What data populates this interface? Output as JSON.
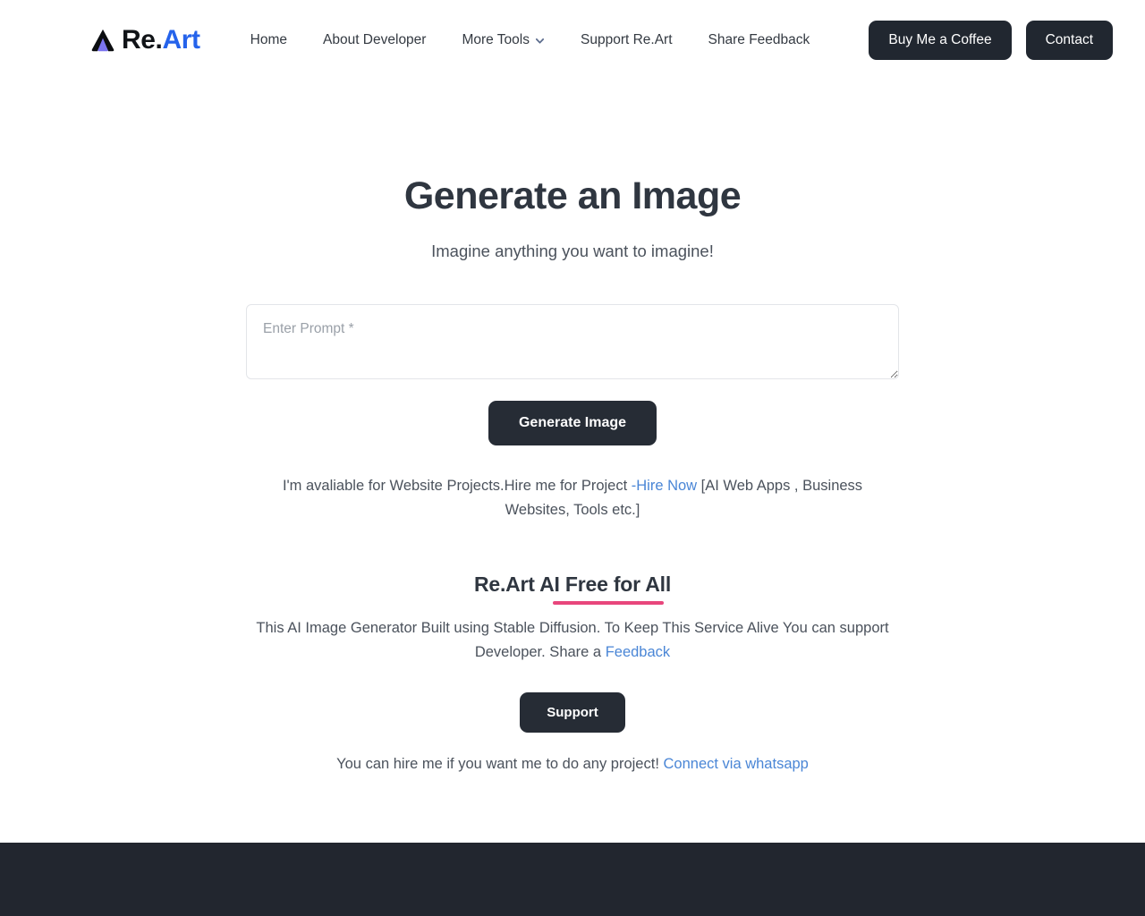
{
  "brand": {
    "logo_icon": "triangle-logo-icon",
    "name_dark": "Re.",
    "name_blue": "Art"
  },
  "nav": {
    "items": [
      {
        "label": "Home",
        "icon": null
      },
      {
        "label": "About Developer",
        "icon": null
      },
      {
        "label": "More Tools",
        "icon": "chevron-down-icon"
      },
      {
        "label": "Support Re.Art",
        "icon": null
      },
      {
        "label": "Share Feedback",
        "icon": null
      }
    ],
    "actions": [
      {
        "label": "Buy Me a Coffee"
      },
      {
        "label": "Contact"
      }
    ]
  },
  "main": {
    "title": "Generate an Image",
    "subtitle": "Imagine anything you want to imagine!",
    "prompt": {
      "placeholder": "Enter Prompt *",
      "value": ""
    },
    "generate_label": "Generate Image",
    "hire_line": {
      "before": "I'm avaliable for Website Projects.Hire me for Project ",
      "link": "-Hire Now",
      "after": " [AI Web Apps , Business Websites, Tools etc.]"
    }
  },
  "free_section": {
    "title": "Re.Art AI Free for All",
    "underline_color": "#e8467c",
    "description": {
      "before": "This AI Image Generator Built using Stable Diffusion. To Keep This Service Alive You can support Developer. Share a ",
      "link": "Feedback"
    },
    "support_label": "Support",
    "hire_line2": {
      "before": "You can hire me if you want me to do any project! ",
      "link": "Connect via whatsapp"
    }
  },
  "theme": {
    "accent_blue": "#2563eb",
    "link_blue": "#4a86d6",
    "dark": "#262c35",
    "pink": "#e8467c",
    "footer_bg": "#22262f"
  }
}
